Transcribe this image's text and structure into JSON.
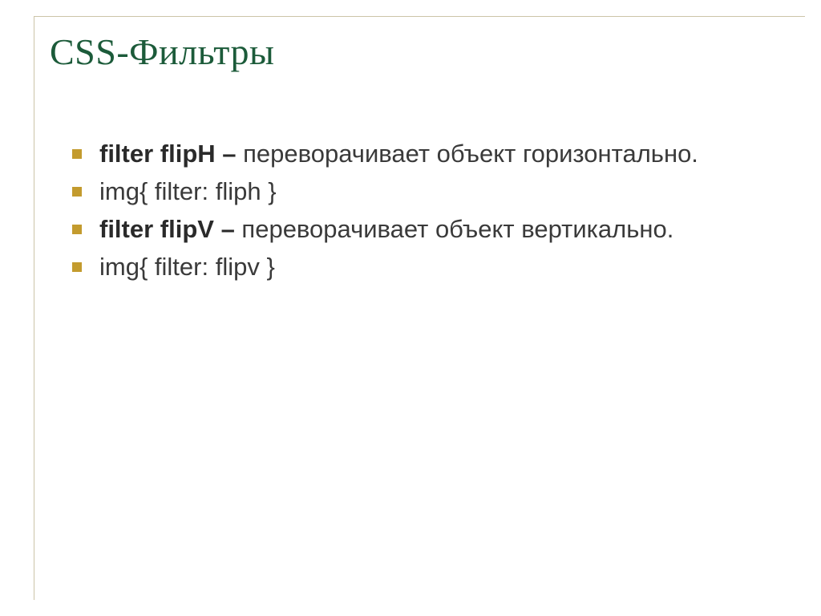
{
  "title": "CSS-Фильтры",
  "items": [
    {
      "bold": "filter flipH – ",
      "text": "переворачивает объект горизонтально."
    },
    {
      "bold": "",
      "text": "img{ filter: fliph }"
    },
    {
      "bold": "filter flipV – ",
      "text": "переворачивает  объект вертикально."
    },
    {
      "bold": "",
      "text": "img{ filter: flipv }"
    }
  ]
}
